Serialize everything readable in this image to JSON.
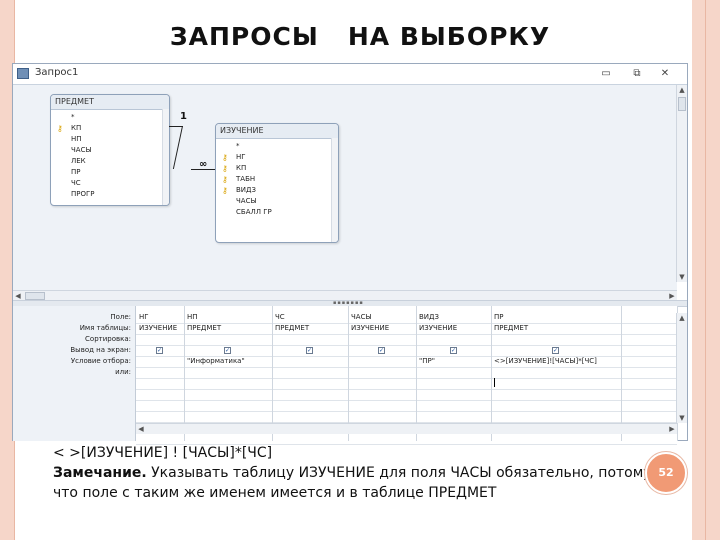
{
  "slide": {
    "title": "ЗАПРОСЫ   НА ВЫБОРКУ",
    "page_number": "52"
  },
  "window": {
    "title": "Запрос1",
    "buttons": {
      "minimize": "▭",
      "restore": "⧉",
      "close": "✕"
    }
  },
  "tables": {
    "predmet": {
      "name": "ПРЕДМЕТ",
      "fields": [
        {
          "label": "*",
          "key": false
        },
        {
          "label": "КП",
          "key": true
        },
        {
          "label": "НП",
          "key": false
        },
        {
          "label": "ЧАСЫ",
          "key": false
        },
        {
          "label": "ЛЕК",
          "key": false
        },
        {
          "label": "ПР",
          "key": false
        },
        {
          "label": "ЧС",
          "key": false
        },
        {
          "label": "ПРОГР",
          "key": false
        }
      ]
    },
    "izuchenie": {
      "name": "ИЗУЧЕНИЕ",
      "fields": [
        {
          "label": "*",
          "key": false
        },
        {
          "label": "НГ",
          "key": true
        },
        {
          "label": "КП",
          "key": true
        },
        {
          "label": "ТАБН",
          "key": true
        },
        {
          "label": "ВИДЗ",
          "key": true
        },
        {
          "label": "ЧАСЫ",
          "key": false
        },
        {
          "label": "СБАЛЛ ГР",
          "key": false
        }
      ]
    },
    "relationship": {
      "one": "1",
      "many": "∞"
    }
  },
  "grid": {
    "row_labels": [
      "Поле:",
      "Имя таблицы:",
      "Сортировка:",
      "Вывод на экран:",
      "Условие отбора:",
      "или:"
    ],
    "columns": [
      {
        "field": "НГ",
        "table": "ИЗУЧЕНИЕ",
        "show": true,
        "criteria": ""
      },
      {
        "field": "НП",
        "table": "ПРЕДМЕТ",
        "show": true,
        "criteria": "\"Информатика\""
      },
      {
        "field": "ЧС",
        "table": "ПРЕДМЕТ",
        "show": true,
        "criteria": ""
      },
      {
        "field": "ЧАСЫ",
        "table": "ИЗУЧЕНИЕ",
        "show": true,
        "criteria": ""
      },
      {
        "field": "ВИДЗ",
        "table": "ИЗУЧЕНИЕ",
        "show": true,
        "criteria": "\"ПР\""
      },
      {
        "field": "ПР",
        "table": "ПРЕДМЕТ",
        "show": true,
        "criteria": "<>[ИЗУЧЕНИЕ]![ЧАСЫ]*[ЧС]"
      },
      {
        "field": "",
        "table": "",
        "show": false,
        "criteria": ""
      }
    ]
  },
  "caption": {
    "line1": "< >[ИЗУЧЕНИЕ] ! [ЧАСЫ]*[ЧС]",
    "note_label": "Замечание.",
    "note_text": " Указывать таблицу ИЗУЧЕНИЕ для поля ЧАСЫ обязательно, потому что поле с таким же именем имеется и в таблице ПРЕДМЕТ"
  },
  "colors": {
    "frame": "#f6d6c9",
    "badge": "#f19a75",
    "design_bg": "#eef2f7"
  }
}
